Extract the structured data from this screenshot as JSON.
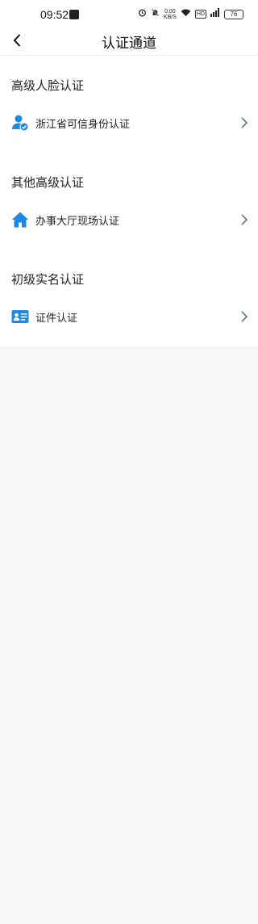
{
  "status_bar": {
    "time": "09:52",
    "net_speed_value": "0.00",
    "net_speed_unit": "KB/S",
    "hd_label": "HD",
    "battery": "76",
    "icons": [
      "app-notification-icon",
      "alarm-icon",
      "mute-icon",
      "wifi-icon",
      "signal-icon",
      "battery-icon"
    ]
  },
  "nav": {
    "title": "认证通道",
    "back_icon": "back-arrow-icon"
  },
  "sections": [
    {
      "title": "高级人脸认证",
      "items": [
        {
          "label": "浙江省可信身份认证",
          "icon": "verified-user-icon"
        }
      ]
    },
    {
      "title": "其他高级认证",
      "items": [
        {
          "label": "办事大厅现场认证",
          "icon": "home-icon"
        }
      ]
    },
    {
      "title": "初级实名认证",
      "items": [
        {
          "label": "证件认证",
          "icon": "id-card-icon"
        }
      ]
    }
  ],
  "colors": {
    "accent": "#1e88e5",
    "chevron": "#6f7a8a",
    "background": "#f7f7f9"
  }
}
